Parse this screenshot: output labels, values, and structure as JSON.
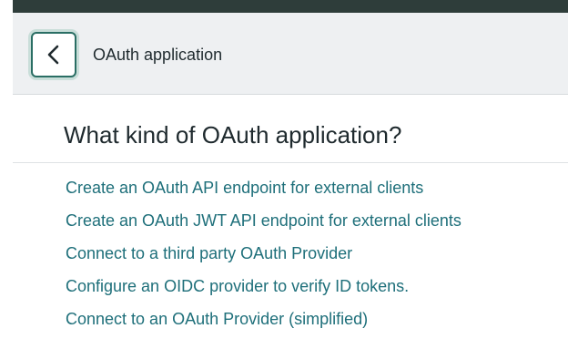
{
  "header": {
    "back_icon": "chevron-left-icon",
    "title": "OAuth application"
  },
  "main": {
    "heading": "What kind of OAuth application?",
    "options": [
      {
        "label": "Create an OAuth API endpoint for external clients"
      },
      {
        "label": "Create an OAuth JWT API endpoint for external clients"
      },
      {
        "label": "Connect to a third party OAuth Provider"
      },
      {
        "label": "Configure an OIDC provider to verify ID tokens."
      },
      {
        "label": "Connect to an OAuth Provider (simplified)"
      }
    ]
  },
  "colors": {
    "link": "#1e6f7a",
    "header_bg": "#eef0f2",
    "top_strip": "#2e3d3a",
    "focus_border": "#2a6e64"
  }
}
